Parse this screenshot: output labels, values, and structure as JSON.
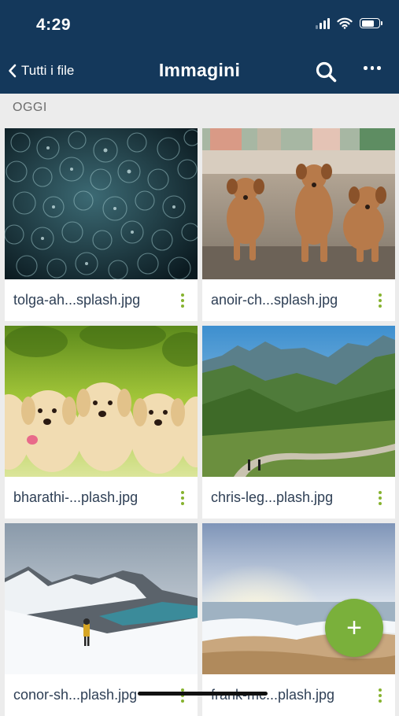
{
  "status": {
    "time": "4:29"
  },
  "nav": {
    "back_label": "Tutti i file",
    "title": "Immagini"
  },
  "section": {
    "label": "OGGI"
  },
  "files": [
    {
      "name": "tolga-ah...splash.jpg"
    },
    {
      "name": "anoir-ch...splash.jpg"
    },
    {
      "name": "bharathi-...plash.jpg"
    },
    {
      "name": "chris-leg...plash.jpg"
    },
    {
      "name": "conor-sh...plash.jpg"
    },
    {
      "name": "frank-mc...plash.jpg"
    }
  ],
  "fab": {
    "label": "+"
  },
  "colors": {
    "header": "#14385b",
    "accent": "#7ab03b",
    "background": "#ececec",
    "file_text": "#2e3f55"
  }
}
